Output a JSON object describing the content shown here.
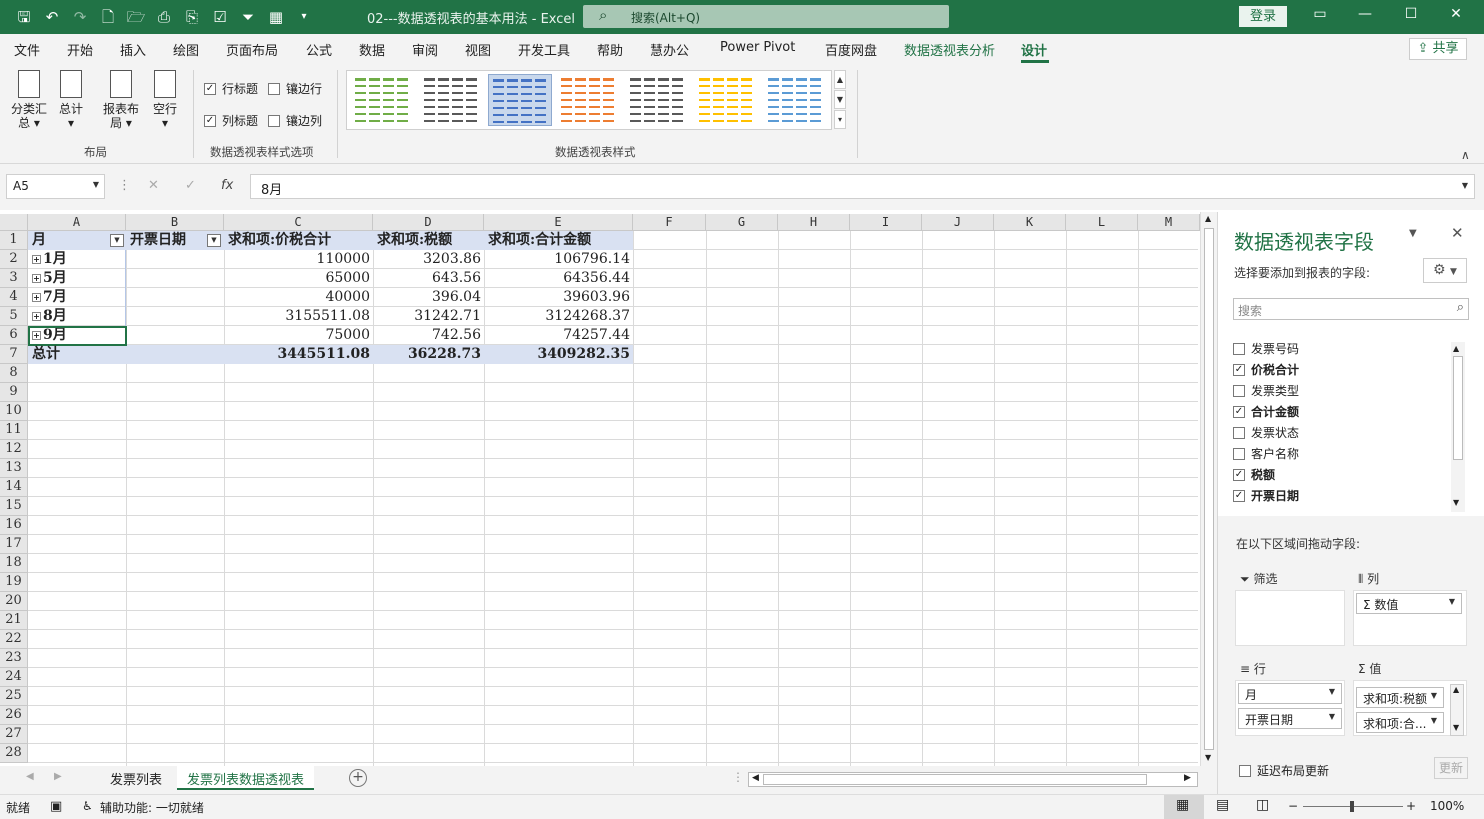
{
  "window": {
    "title": "02---数据透视表的基本用法  -  Excel",
    "search_placeholder": "搜索(Alt+Q)",
    "login_label": "登录"
  },
  "menu": {
    "tabs": [
      "文件",
      "开始",
      "插入",
      "绘图",
      "页面布局",
      "公式",
      "数据",
      "审阅",
      "视图",
      "开发工具",
      "帮助",
      "慧办公",
      "Power Pivot",
      "百度网盘",
      "数据透视表分析",
      "设计"
    ],
    "active_tab": "设计",
    "share_label": "共享"
  },
  "ribbon": {
    "layout_buttons": [
      "分类汇\n总",
      "总计",
      "报表布\n局",
      "空行"
    ],
    "layout_group": "布局",
    "style_options": [
      {
        "label": "行标题",
        "checked": true
      },
      {
        "label": "镶边行",
        "checked": false
      },
      {
        "label": "列标题",
        "checked": true
      },
      {
        "label": "镶边列",
        "checked": false
      }
    ],
    "style_options_group": "数据透视表样式选项",
    "styles_group": "数据透视表样式",
    "style_colors": [
      "#70ad47",
      "#595959",
      "#4472c4",
      "#ed7d31",
      "#595959",
      "#ffc000",
      "#5b9bd5"
    ],
    "selected_style_index": 2
  },
  "formula_bar": {
    "name_box": "A5",
    "formula": "8月"
  },
  "grid": {
    "columns": [
      "A",
      "B",
      "C",
      "D",
      "E",
      "F",
      "G",
      "H",
      "I",
      "J",
      "K",
      "L",
      "M"
    ],
    "rows": [
      "1",
      "2",
      "3",
      "4",
      "5",
      "6",
      "7",
      "8",
      "9",
      "10",
      "11",
      "12",
      "13",
      "14",
      "15",
      "16",
      "17",
      "18",
      "19",
      "20",
      "21",
      "22",
      "23",
      "24",
      "25",
      "26",
      "27",
      "28"
    ],
    "header_row": [
      "月",
      "开票日期",
      "求和项:价税合计",
      "求和项:税额",
      "求和项:合计金额"
    ],
    "data_rows": [
      [
        "1月",
        "",
        "110000",
        "3203.86",
        "106796.14"
      ],
      [
        "5月",
        "",
        "65000",
        "643.56",
        "64356.44"
      ],
      [
        "7月",
        "",
        "40000",
        "396.04",
        "39603.96"
      ],
      [
        "8月",
        "",
        "3155511.08",
        "31242.71",
        "3124268.37"
      ],
      [
        "9月",
        "",
        "75000",
        "742.56",
        "74257.44"
      ]
    ],
    "total_row": [
      "总计",
      "",
      "3445511.08",
      "36228.73",
      "3409282.35"
    ]
  },
  "sheet_tabs": [
    "发票列表",
    "发票列表数据透视表"
  ],
  "active_sheet": "发票列表数据透视表",
  "status": {
    "ready": "就绪",
    "accessibility": "辅助功能: 一切就绪",
    "zoom": "100%"
  },
  "pivot_pane": {
    "title": "数据透视表字段",
    "subtitle": "选择要添加到报表的字段:",
    "search_placeholder": "搜索",
    "fields": [
      {
        "label": "发票号码",
        "checked": false
      },
      {
        "label": "价税合计",
        "checked": true
      },
      {
        "label": "发票类型",
        "checked": false
      },
      {
        "label": "合计金额",
        "checked": true
      },
      {
        "label": "发票状态",
        "checked": false
      },
      {
        "label": "客户名称",
        "checked": false
      },
      {
        "label": "税额",
        "checked": true
      },
      {
        "label": "开票日期",
        "checked": true
      }
    ],
    "drag_hint": "在以下区域间拖动字段:",
    "filters_label": "筛选",
    "columns_label": "列",
    "rows_label": "行",
    "values_label": "值",
    "columns_items": [
      "Σ 数值"
    ],
    "rows_items": [
      "月",
      "开票日期"
    ],
    "values_items": [
      "求和项:税额",
      "求和项:合..."
    ],
    "defer_label": "延迟布局更新",
    "update_label": "更新"
  }
}
